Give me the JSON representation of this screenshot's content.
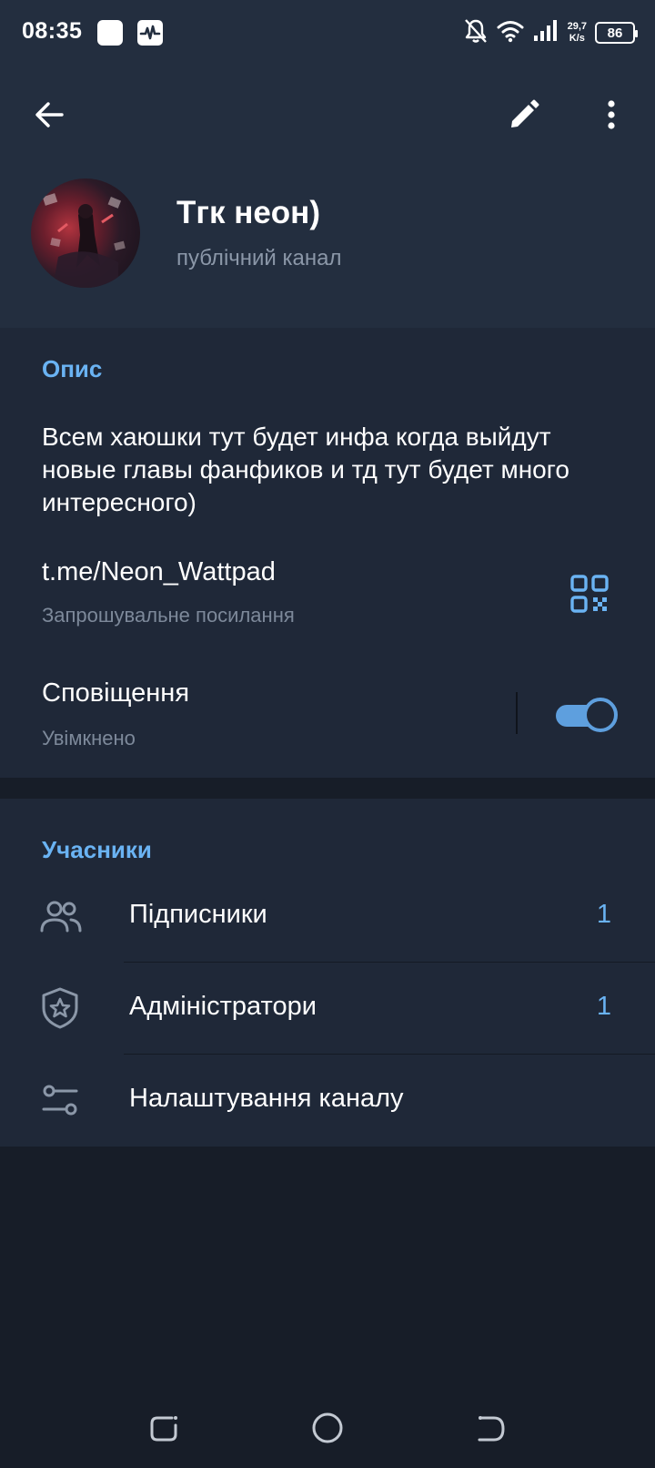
{
  "status_bar": {
    "time": "08:35",
    "speed_value": "29,7",
    "speed_unit": "K/s",
    "battery": "86"
  },
  "header": {
    "channel_name": "Тгк неон)",
    "channel_type": "публічний канал"
  },
  "info": {
    "section_title": "Опис",
    "description": "Всем хаюшки тут будет инфа когда выйдут новые главы фанфиков и тд тут будет много интересного)",
    "link": "t.me/Neon_Wattpad",
    "link_subtitle": "Запрошувальне посилання",
    "notifications_label": "Сповіщення",
    "notifications_state": "Увімкнено",
    "notifications_enabled": true
  },
  "members": {
    "section_title": "Учасники",
    "items": [
      {
        "label": "Підписники",
        "count": "1",
        "icon": "users-icon"
      },
      {
        "label": "Адміністратори",
        "count": "1",
        "icon": "shield-star-icon"
      },
      {
        "label": "Налаштування каналу",
        "count": "",
        "icon": "sliders-icon"
      }
    ]
  },
  "colors": {
    "accent": "#6ab3f3",
    "toggle": "#5e9fde",
    "header_bg": "#232e3f",
    "section_bg": "#1f2838",
    "page_bg": "#171d28"
  }
}
